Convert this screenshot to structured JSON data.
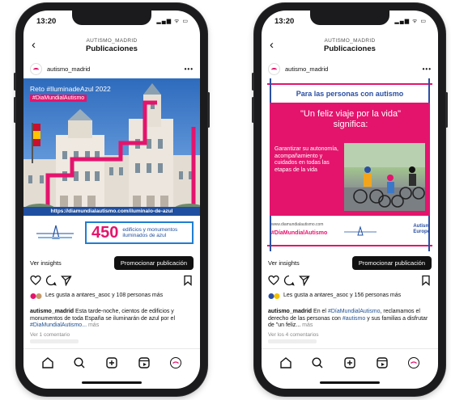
{
  "status": {
    "time": "13:20",
    "icons": "▂▄▆ ᯤ ▭"
  },
  "nav": {
    "back": "‹",
    "account": "AUTISMO_MADRID",
    "title": "Publicaciones"
  },
  "colors": {
    "accent": "#e4146d",
    "blue": "#2b4fa3",
    "promo_bg": "#111111"
  },
  "posts": [
    {
      "username": "autismo_madrid",
      "more": "•••",
      "media": {
        "banner": "Reto #IluminadeAzul 2022",
        "hashtag": "#DiaMundialAutismo",
        "url": "https://diamundialautismo.com/iluminalo-de-azul",
        "number": "450",
        "number_text_1": "edificios y monumentos",
        "number_text_2": "iluminados de azul"
      },
      "insights": "Ver insights",
      "promote": "Promocionar publicación",
      "likes": "Les gusta a antares_asoc y 108 personas más",
      "caption_user": "autismo_madrid",
      "caption_text": " Esta tarde-noche, cientos de edificios y monumentos de toda España se iluminarán de azul por el ",
      "caption_tag": "#DiaMundialAutismo...",
      "caption_more": " más",
      "comments": "Ver 1 comentario"
    },
    {
      "username": "autismo_madrid",
      "more": "•••",
      "media": {
        "title": "Para las personas con autismo",
        "quote_1": "\"Un feliz viaje por la vida\"",
        "quote_2": "significa:",
        "body": "Garantizar su autonomía, acompañamiento y cuidados en todas las etapas de la vida",
        "site": "www.diamundialautismo.com",
        "hashtag": "#DíaMundialAutismo",
        "eu_1": "Autism",
        "eu_2": "Europe"
      },
      "insights": "Ver insights",
      "promote": "Promocionar publicación",
      "likes": "Les gusta a antares_asoc y 156 personas más",
      "caption_user": "autismo_madrid",
      "caption_text_1": " En el ",
      "caption_tag_1": "#DíaMundialAutismo",
      "caption_text_2": ", reclamamos el derecho de las personas con ",
      "caption_tag_2": "#autismo",
      "caption_text_3": " y sus familias a disfrutar de \"un feliz...",
      "caption_more": " más",
      "comments": "Ver los 4 comentarios"
    }
  ]
}
